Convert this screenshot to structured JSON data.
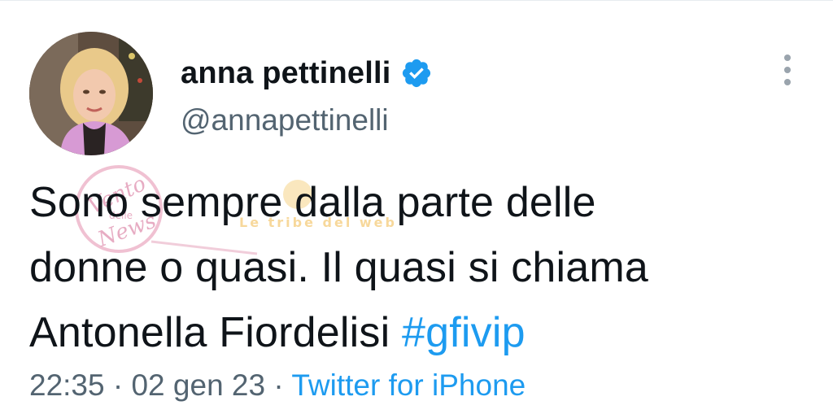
{
  "tweet": {
    "display_name": "anna pettinelli",
    "handle": "@annapettinelli",
    "verified": true,
    "text_lines": [
      "Sono sempre dalla parte delle",
      "donne o quasi. Il quasi si chiama",
      "Antonella Fiordelisi"
    ],
    "hashtag": "#gfivip",
    "time": "22:35",
    "date": "02 gen 23",
    "separator": "·",
    "source": "Twitter for iPhone"
  },
  "icons": {
    "verified_badge": "verified-badge-icon",
    "more": "more-options-icon"
  },
  "colors": {
    "text": "#0f1419",
    "secondary": "#536471",
    "link": "#1d9bf0",
    "verified": "#1d9bf0"
  },
  "watermark": {
    "text_1": "Vento",
    "text_2": "delle",
    "text_3": "News",
    "text_4": "Le tribe del web"
  }
}
